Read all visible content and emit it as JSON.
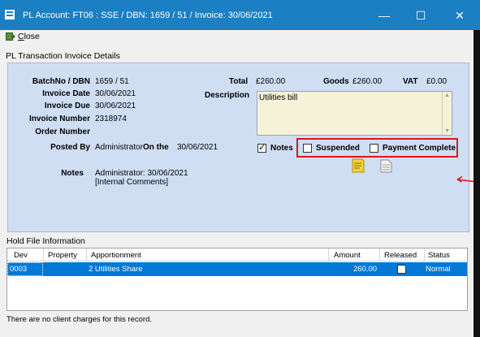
{
  "window": {
    "title": "PL Account: FT06  : SSE  /  DBN: 1659 / 51  /  Invoice: 30/06/2021",
    "min_glyph": "—",
    "max_glyph": "☐",
    "close_glyph": "✕"
  },
  "menu": {
    "close_first": "C",
    "close_rest": "lose"
  },
  "details": {
    "section_label": "PL Transaction Invoice Details",
    "batch_label": "BatchNo / DBN",
    "batch_value": "1659 / 51",
    "invoice_date_label": "Invoice Date",
    "invoice_date_value": "30/06/2021",
    "invoice_due_label": "Invoice Due",
    "invoice_due_value": "30/06/2021",
    "invoice_number_label": "Invoice Number",
    "invoice_number_value": "2318974",
    "order_number_label": "Order Number",
    "order_number_value": "",
    "posted_by_label": "Posted By",
    "posted_by_value": "Administrator",
    "on_the_label": "On the",
    "on_the_value": "30/06/2021",
    "total_label": "Total",
    "total_value": "£260.00",
    "goods_label": "Goods",
    "goods_value": "£260.00",
    "vat_label": "VAT",
    "vat_value": "£0.00",
    "description_label": "Description",
    "description_value": "Utilities bill",
    "notes_checkbox_label": "Notes",
    "notes_checked": true,
    "suspended_label": "Suspended",
    "suspended_checked": false,
    "payment_complete_label": "Payment Complete",
    "payment_complete_checked": false,
    "notes_label": "Notes",
    "notes_line1": "Administrator: 30/06/2021",
    "notes_line2": "[Internal Comments]"
  },
  "hold": {
    "section_label": "Hold File Information",
    "columns": [
      "Dev",
      "Property",
      "Apportionment",
      "Amount",
      "Released",
      "Status"
    ],
    "rows": [
      {
        "dev": "0003",
        "property": "",
        "apportionment": "2  Utilities Share",
        "amount": "260.00",
        "released": false,
        "status": "Normal"
      }
    ]
  },
  "footer": {
    "message": "There are no client charges for this record."
  },
  "colors": {
    "titlebar": "#1b7fc3",
    "panel": "#d0def4",
    "highlight_box": "#e0121b",
    "selected_row": "#0078d7"
  },
  "icons": [
    "app-icon",
    "close-menu-icon",
    "sticky-note-icon",
    "document-icon",
    "red-arrow-icon"
  ]
}
